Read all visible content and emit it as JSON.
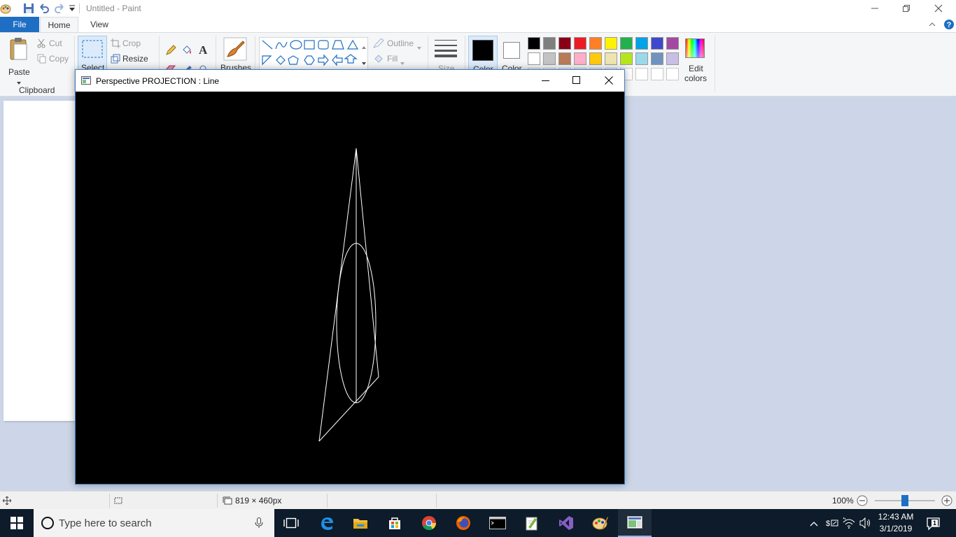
{
  "app": {
    "title": "Untitled - Paint"
  },
  "ribbon_tabs": [
    "File",
    "Home",
    "View"
  ],
  "ribbon": {
    "clipboard": {
      "paste": "Paste",
      "cut": "Cut",
      "copy": "Copy",
      "group_label": "Clipboard"
    },
    "image": {
      "select": "Select",
      "crop": "Crop",
      "resize": "Resize"
    },
    "brushes": "Brushes",
    "shapes": {
      "outline": "Outline",
      "fill": "Fill"
    },
    "size": "Size",
    "color1": "Color",
    "color2": "Color",
    "edit_colors_line1": "Edit",
    "edit_colors_line2": "colors",
    "palette_row1": [
      "#000000",
      "#7f7f7f",
      "#880015",
      "#ed1c24",
      "#ff7f27",
      "#fff200",
      "#22b14c",
      "#00a2e8",
      "#3f48cc",
      "#a349a4"
    ],
    "palette_row2": [
      "#ffffff",
      "#c3c3c3",
      "#b97a57",
      "#ffaec9",
      "#ffc90e",
      "#efe4b0",
      "#b5e61d",
      "#99d9ea",
      "#7092be",
      "#c8bfe7"
    ]
  },
  "gl_window": {
    "title": "Perspective PROJECTION : Line"
  },
  "statusbar": {
    "canvas_size": "819 × 460px",
    "zoom": "100%",
    "zoom_level": 0.5
  },
  "taskbar": {
    "search_placeholder": "Type here to search",
    "apps": [
      "task-view",
      "edge",
      "file-explorer",
      "store",
      "chrome",
      "firefox",
      "cmd",
      "notepad-plus-plus",
      "visual-studio",
      "paint",
      "opengl-window"
    ],
    "time": "12:43 AM",
    "date": "3/1/2019",
    "notification_count": "1"
  }
}
